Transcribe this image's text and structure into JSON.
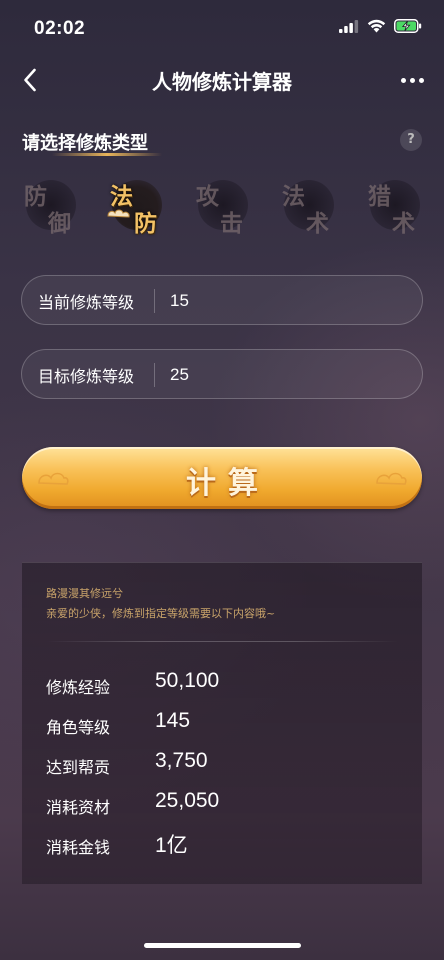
{
  "status": {
    "time": "02:02",
    "battery_color": "#4cd964"
  },
  "nav": {
    "title": "人物修炼计算器",
    "back_icon": "chevron-left-icon",
    "more_icon": "more-horizontal-icon"
  },
  "cultivation": {
    "title": "请选择修炼类型",
    "help": "?",
    "types": [
      {
        "c1": "防",
        "c2": "御",
        "selected": false
      },
      {
        "c1": "法",
        "c2": "防",
        "selected": true
      },
      {
        "c1": "攻",
        "c2": "击",
        "selected": false
      },
      {
        "c1": "法",
        "c2": "术",
        "selected": false
      },
      {
        "c1": "猎",
        "c2": "术",
        "selected": false
      }
    ]
  },
  "inputs": {
    "current": {
      "label": "当前修炼等级",
      "value": "15"
    },
    "target": {
      "label": "目标修炼等级",
      "value": "25"
    }
  },
  "calc_button": {
    "label": "计算",
    "color": "#f5b544"
  },
  "result": {
    "poem_line1": "路漫漫其修远兮",
    "poem_line2": "亲爱的少侠，修炼到指定等级需要以下内容哦~",
    "rows": [
      {
        "label": "修炼经验",
        "value": "50,100"
      },
      {
        "label": "角色等级",
        "value": "145"
      },
      {
        "label": "达到帮贡",
        "value": "3,750"
      },
      {
        "label": "消耗资材",
        "value": "25,050"
      },
      {
        "label": "消耗金钱",
        "value": "1亿"
      }
    ]
  }
}
